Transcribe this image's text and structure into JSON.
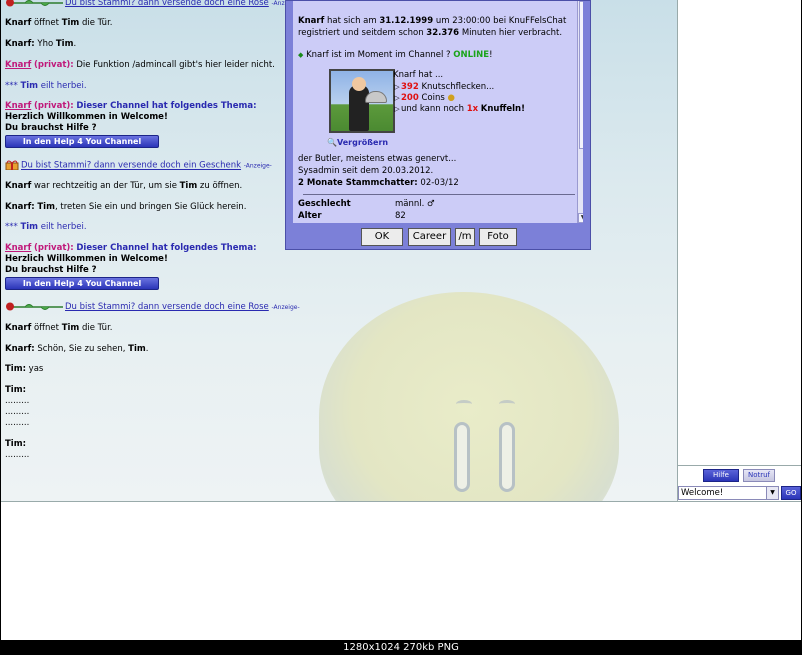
{
  "caption": "1280x1024  270kb  PNG",
  "chat": {
    "line1": {
      "link": "Du bist Stammi? dann versende doch eine Rose",
      "ad": "-Anzeige-"
    },
    "line2": {
      "nick": "Knarf",
      "text1": "öffnet",
      "nick2": "Tim",
      "text2": "die Tür."
    },
    "line3": {
      "nick": "Knarf:",
      "text1": "Yho",
      "nick2": "Tim",
      "text2": "."
    },
    "line4": {
      "nick": "Knarf",
      "lbl": "(privat):",
      "text": "Die Funktion /admincall gibt's hier leider nicht."
    },
    "line5": {
      "stars": "***",
      "nick": "Tim",
      "text": "eilt herbei."
    },
    "line6": {
      "nick": "Knarf",
      "lbl": "(privat):",
      "topic": "Dieser Channel hat folgendes Thema:"
    },
    "line7": "Herzlich Willkommen in Welcome!",
    "line8": "Du brauchst Hilfe ?",
    "help_button": "In den Help 4 You Channel",
    "line9": {
      "link": "Du bist Stammi? dann versende doch ein Geschenk",
      "ad": "-Anzeige-"
    },
    "line10": {
      "nick": "Knarf",
      "text1": "war rechtzeitig an der Tür, um sie",
      "nick2": "Tim",
      "text2": "zu öffnen."
    },
    "line11": {
      "nick": "Knarf:",
      "nick2": "Tim",
      "text": ", treten Sie ein und bringen Sie Glück herein."
    },
    "line12": {
      "stars": "***",
      "nick": "Tim",
      "text": "eilt herbei."
    },
    "line13": {
      "nick": "Knarf",
      "lbl": "(privat):",
      "topic": "Dieser Channel hat folgendes Thema:"
    },
    "line14": "Herzlich Willkommen in Welcome!",
    "line15": "Du brauchst Hilfe ?",
    "help_button2": "In den Help 4 You Channel",
    "line16": {
      "link": "Du bist Stammi? dann versende doch eine Rose",
      "ad": "-Anzeige-"
    },
    "line17": {
      "nick": "Knarf",
      "text1": "öffnet",
      "nick2": "Tim",
      "text2": "die Tür."
    },
    "line18": {
      "nick": "Knarf:",
      "text1": "Schön, Sie zu sehen,",
      "nick2": "Tim",
      "text2": "."
    },
    "line19": {
      "nick": "Tim:",
      "text": "yas"
    },
    "line20": {
      "nick": "Tim:"
    },
    "dots": ".........",
    "line21": {
      "nick": "Tim:"
    }
  },
  "profile": {
    "intro_nick": "Knarf",
    "intro_text1": "hat sich am",
    "reg_date": "31.12.1999",
    "intro_text2": "um 23:00:00 bei KnuFFelsChat",
    "intro_text3": "registriert und seitdem schon",
    "minutes": "32.376",
    "intro_text4": "Minuten hier verbracht.",
    "online_text": "Knarf ist im Moment im Channel ?",
    "online_status": "ONLINE",
    "online_bang": "!",
    "has_text": "Knarf hat ...",
    "knutsch_count": "392",
    "knutsch_label": "Knutschflecken...",
    "coins_count": "200",
    "coins_label": "Coins",
    "knuffel_pre": "und kann noch",
    "knuffel_count": "1x",
    "knuffel_label": "Knuffeln!",
    "enlarge": "Vergrößern",
    "desc1": "der Butler, meistens etwas genervt...",
    "desc2": "Sysadmin seit dem 20.03.2012.",
    "desc3_bold": "2 Monate Stammchatter:",
    "desc3_rest": "02-03/12",
    "gender_label": "Geschlecht",
    "gender_value": "männl.",
    "age_label": "Alter",
    "age_value": "82",
    "buttons": {
      "ok": "OK",
      "career": "Career",
      "m": "/m",
      "foto": "Foto"
    }
  },
  "right_panel": {
    "hilfe": "Hilfe",
    "notruf": "Notruf",
    "channel": "Welcome!",
    "go": "GO"
  }
}
